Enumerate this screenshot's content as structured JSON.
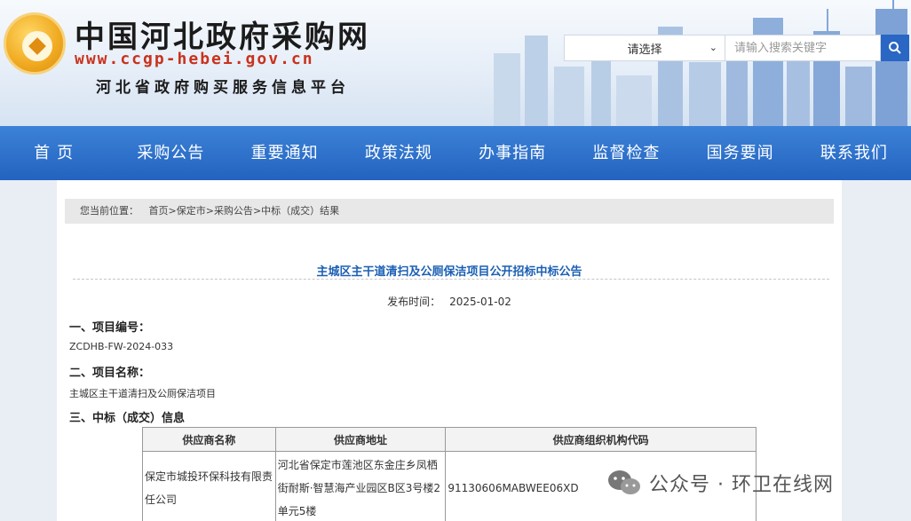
{
  "header": {
    "site_title": "中国河北政府采购网",
    "site_url": "www.ccgp-hebei.gov.cn",
    "site_subtitle": "河北省政府购买服务信息平台",
    "search": {
      "select_value": "请选择",
      "placeholder": "请输入搜索关键字"
    }
  },
  "nav": {
    "items": [
      "首页",
      "采购公告",
      "重要通知",
      "政策法规",
      "办事指南",
      "监督检查",
      "国务要闻",
      "联系我们"
    ]
  },
  "breadcrumb": {
    "prefix": "您当前位置：",
    "items": [
      "首页",
      "保定市",
      "采购公告",
      "中标（成交）结果"
    ],
    "separator": ">"
  },
  "notice": {
    "title": "主城区主干道清扫及公厕保洁项目公开招标中标公告",
    "publish_label": "发布时间：",
    "publish_date": "2025-01-02",
    "sections": [
      {
        "heading": "一、项目编号：",
        "value": "ZCDHB-FW-2024-033"
      },
      {
        "heading": "二、项目名称：",
        "value": "主城区主干道清扫及公厕保洁项目"
      },
      {
        "heading": "三、中标（成交）信息",
        "value": ""
      }
    ],
    "table": {
      "headers": [
        "供应商名称",
        "供应商地址",
        "供应商组织机构代码"
      ],
      "rows": [
        [
          "保定市城投环保科技有限责任公司",
          "河北省保定市莲池区东金庄乡凤栖街耐斯·智慧海产业园区B区3号楼2单元5楼",
          "91130606MABWEE06XD"
        ]
      ]
    }
  },
  "watermark": {
    "text": "公众号 · 环卫在线网"
  },
  "colors": {
    "nav_bg": "#2a6bc8",
    "title_blue": "#1b5fb4",
    "url_red": "#c9321c",
    "search_btn": "#2a66c3"
  }
}
